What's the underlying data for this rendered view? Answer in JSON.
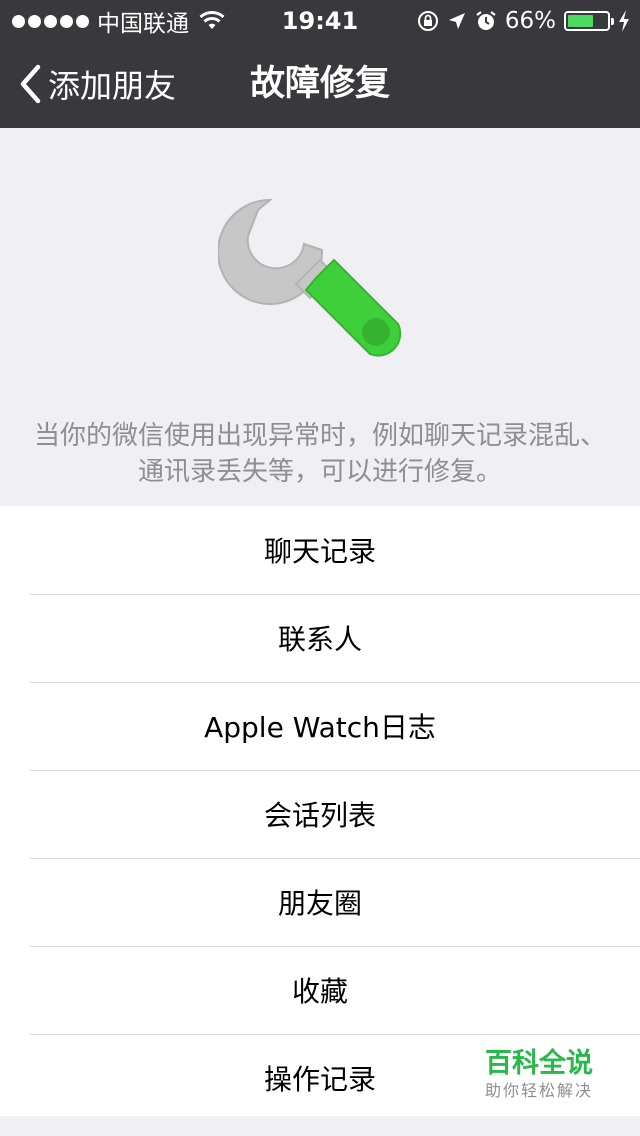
{
  "status_bar": {
    "carrier": "中国联通",
    "time": "19:41",
    "battery_percent": "66%",
    "battery_level": 0.66,
    "icons": [
      "signal-dots-icon",
      "wifi-icon",
      "rotation-lock-icon",
      "location-arrow-icon",
      "alarm-icon",
      "battery-icon",
      "charging-bolt-icon"
    ]
  },
  "nav": {
    "back_label": "添加朋友",
    "title": "故障修复"
  },
  "hero": {
    "icon": "wrench-icon",
    "description": "当你的微信使用出现异常时，例如聊天记录混乱、通讯录丢失等，可以进行修复。"
  },
  "list": {
    "items": [
      {
        "label": "聊天记录"
      },
      {
        "label": "联系人"
      },
      {
        "label": "Apple Watch日志"
      },
      {
        "label": "会话列表"
      },
      {
        "label": "朋友圈"
      },
      {
        "label": "收藏"
      },
      {
        "label": "操作记录"
      }
    ]
  },
  "watermark": {
    "title": "百科全说",
    "subtitle": "助你轻松解决"
  },
  "colors": {
    "nav_background": "#38383d",
    "page_background": "#efeff4",
    "wrench_green": "#3fcf3a",
    "wrench_gray": "#c7c7c7",
    "battery_green": "#4cd964",
    "watermark_green": "#29b84a"
  }
}
